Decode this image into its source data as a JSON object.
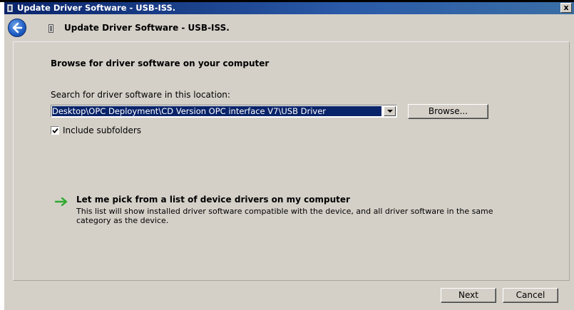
{
  "window": {
    "title": "Update Driver Software - USB-ISS.",
    "close_label": "x"
  },
  "header": {
    "title": "Update Driver Software - USB-ISS."
  },
  "main": {
    "heading": "Browse for driver software on your computer",
    "search_label": "Search for driver software in this location:",
    "path_value": "Desktop\\OPC Deployment\\CD Version OPC interface V7\\USB Driver",
    "browse_label": "Browse...",
    "include_subfolders_label": "Include subfolders",
    "include_subfolders_checked": true,
    "pick_link": "Let me pick from a list of device drivers on my computer",
    "pick_description": "This list will show installed driver software compatible with the device, and all driver software in the same category as the device."
  },
  "footer": {
    "next_label": "Next",
    "cancel_label": "Cancel"
  },
  "colors": {
    "title_bar": "#0a246a",
    "dialog_bg": "#d4d0c8",
    "selection": "#0a246a",
    "link_arrow": "#2eaa2e"
  },
  "icons": [
    "back-arrow-icon",
    "device-icon",
    "checkmark-icon",
    "green-arrow-icon",
    "dropdown-arrow-icon"
  ]
}
